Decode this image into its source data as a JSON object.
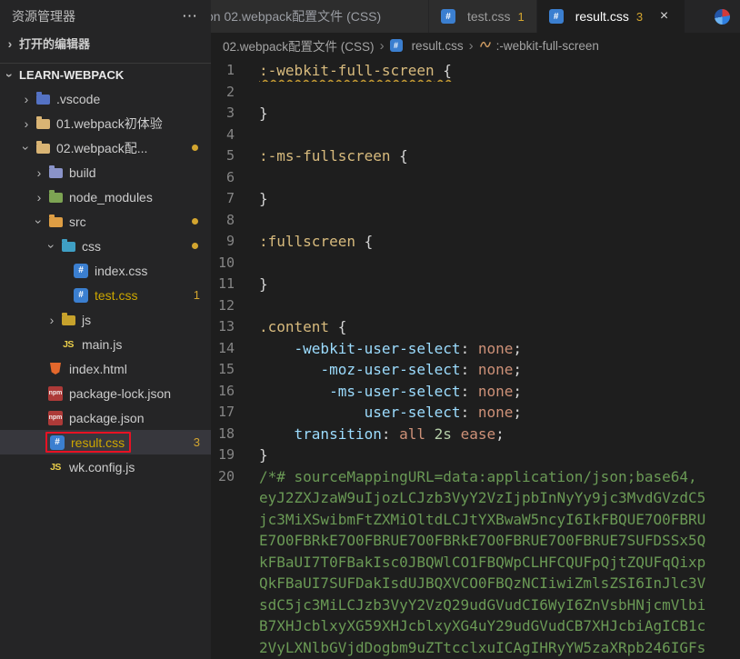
{
  "icons": {
    "chevron": "›",
    "close": "×",
    "more": "⋯",
    "css_glyph": "#",
    "js_glyph": "JS",
    "npm_glyph": "npm"
  },
  "sidebar": {
    "title": "资源管理器",
    "open_editors_label": "打开的编辑器",
    "section_label": "LEARN-WEBPACK",
    "tree": [
      {
        "id": "vscode-folder",
        "label": ".vscode",
        "level": 1,
        "chevron": "collapsed",
        "icon": "folder",
        "folder_color": "#5472c4"
      },
      {
        "id": "01-webpack",
        "label": "01.webpack初体验",
        "level": 1,
        "chevron": "collapsed",
        "icon": "folder",
        "folder_color": "#d9b474"
      },
      {
        "id": "02-webpack",
        "label": "02.webpack配...",
        "level": 1,
        "chevron": "expanded",
        "icon": "folder",
        "folder_color": "#d9b474",
        "dot": true
      },
      {
        "id": "build",
        "label": "build",
        "level": 2,
        "chevron": "collapsed",
        "icon": "folder",
        "folder_color": "#8a93c9"
      },
      {
        "id": "node-modules",
        "label": "node_modules",
        "level": 2,
        "chevron": "collapsed",
        "icon": "folder",
        "folder_color": "#7da453"
      },
      {
        "id": "src",
        "label": "src",
        "level": 2,
        "chevron": "expanded",
        "icon": "folder",
        "folder_color": "#de9e44",
        "dot": true
      },
      {
        "id": "css-folder",
        "label": "css",
        "level": 3,
        "chevron": "expanded",
        "icon": "folder",
        "folder_color": "#3f9fc4",
        "dot": true
      },
      {
        "id": "index-css",
        "label": "index.css",
        "level": 4,
        "icon": "css"
      },
      {
        "id": "test-css",
        "label": "test.css",
        "level": 4,
        "icon": "css",
        "badge": "1",
        "warn": true
      },
      {
        "id": "js-folder",
        "label": "js",
        "level": 3,
        "chevron": "collapsed",
        "icon": "folder",
        "folder_color": "#c7a22c"
      },
      {
        "id": "main-js",
        "label": "main.js",
        "level": 3,
        "icon": "js"
      },
      {
        "id": "index-html",
        "label": "index.html",
        "level": 2,
        "icon": "html"
      },
      {
        "id": "package-lock-json",
        "label": "package-lock.json",
        "level": 2,
        "icon": "npm"
      },
      {
        "id": "package-json",
        "label": "package.json",
        "level": 2,
        "icon": "npm"
      },
      {
        "id": "result-css",
        "label": "result.css",
        "level": 2,
        "icon": "css",
        "badge": "3",
        "warn": true,
        "selected": true,
        "outlined": true
      },
      {
        "id": "wk-config-js",
        "label": "wk.config.js",
        "level": 2,
        "icon": "js"
      }
    ]
  },
  "tabbar": {
    "tabs": [
      {
        "id": "tab-02-webpack",
        "label": "on 02.webpack配置文件 (CSS)",
        "clipped": true
      },
      {
        "id": "tab-test-css",
        "label": "test.css",
        "icon": "css",
        "badge": "1"
      },
      {
        "id": "tab-result-css",
        "label": "result.css",
        "icon": "css",
        "badge": "3",
        "active": true,
        "closable": true
      }
    ]
  },
  "breadcrumb": {
    "items": [
      {
        "id": "crumb-folder",
        "label": "02.webpack配置文件 (CSS)"
      },
      {
        "id": "crumb-file",
        "label": "result.css",
        "icon": "css"
      },
      {
        "id": "crumb-symbol",
        "label": ":-webkit-full-screen",
        "icon": "selector"
      }
    ]
  },
  "editor": {
    "lines": [
      {
        "n": "1",
        "tokens": [
          [
            "sel squig",
            ":-webkit-full-screen"
          ],
          [
            "punc squig",
            " {"
          ]
        ]
      },
      {
        "n": "2",
        "tokens": []
      },
      {
        "n": "3",
        "tokens": [
          [
            "punc",
            "}"
          ]
        ]
      },
      {
        "n": "4",
        "tokens": []
      },
      {
        "n": "5",
        "tokens": [
          [
            "sel",
            ":-ms-fullscreen"
          ],
          [
            "punc",
            " {"
          ]
        ]
      },
      {
        "n": "6",
        "tokens": []
      },
      {
        "n": "7",
        "tokens": [
          [
            "punc",
            "}"
          ]
        ]
      },
      {
        "n": "8",
        "tokens": []
      },
      {
        "n": "9",
        "tokens": [
          [
            "sel",
            ":fullscreen"
          ],
          [
            "punc",
            " {"
          ]
        ]
      },
      {
        "n": "10",
        "tokens": []
      },
      {
        "n": "11",
        "tokens": [
          [
            "punc",
            "}"
          ]
        ]
      },
      {
        "n": "12",
        "tokens": []
      },
      {
        "n": "13",
        "tokens": [
          [
            "sel",
            ".content"
          ],
          [
            "punc",
            " {"
          ]
        ]
      },
      {
        "n": "14",
        "tokens": [
          [
            "plain",
            "    "
          ],
          [
            "prop",
            "-webkit-user-select"
          ],
          [
            "punc",
            ": "
          ],
          [
            "val",
            "none"
          ],
          [
            "punc",
            ";"
          ]
        ]
      },
      {
        "n": "15",
        "tokens": [
          [
            "plain",
            "       "
          ],
          [
            "prop",
            "-moz-user-select"
          ],
          [
            "punc",
            ": "
          ],
          [
            "val",
            "none"
          ],
          [
            "punc",
            ";"
          ]
        ]
      },
      {
        "n": "16",
        "tokens": [
          [
            "plain",
            "        "
          ],
          [
            "prop",
            "-ms-user-select"
          ],
          [
            "punc",
            ": "
          ],
          [
            "val",
            "none"
          ],
          [
            "punc",
            ";"
          ]
        ]
      },
      {
        "n": "17",
        "tokens": [
          [
            "plain",
            "            "
          ],
          [
            "prop",
            "user-select"
          ],
          [
            "punc",
            ": "
          ],
          [
            "val",
            "none"
          ],
          [
            "punc",
            ";"
          ]
        ]
      },
      {
        "n": "18",
        "tokens": [
          [
            "plain",
            "    "
          ],
          [
            "prop",
            "transition"
          ],
          [
            "punc",
            ": "
          ],
          [
            "val",
            "all"
          ],
          [
            "num",
            " 2s"
          ],
          [
            "val",
            " ease"
          ],
          [
            "punc",
            ";"
          ]
        ]
      },
      {
        "n": "19",
        "tokens": [
          [
            "punc",
            "}"
          ]
        ]
      },
      {
        "n": "20",
        "tokens": [
          [
            "comment",
            "/*# sourceMappingURL=data:application/json;base64,"
          ]
        ]
      },
      {
        "n": "",
        "tokens": [
          [
            "comment",
            "eyJ2ZXJzaW9uIjozLCJzb3VyY2VzIjpbInNyYy9jc3MvdGVzdC5"
          ]
        ]
      },
      {
        "n": "",
        "tokens": [
          [
            "comment",
            "jc3MiXSwibmFtZXMiOltdLCJtYXBwaW5ncyI6IkFBQUE7O0FBRU"
          ]
        ]
      },
      {
        "n": "",
        "tokens": [
          [
            "comment",
            "E7O0FBRkE7O0FBRUE7O0FBRkE7O0FBRUE7O0FBRUE7SUFDSSx5Q"
          ]
        ]
      },
      {
        "n": "",
        "tokens": [
          [
            "comment",
            "kFBaUI7T0FBakIsc0JBQWlCO1FBQWpCLHFCQUFpQjtZQUFqQixp"
          ]
        ]
      },
      {
        "n": "",
        "tokens": [
          [
            "comment",
            "QkFBaUI7SUFDakIsdUJBQXVCO0FBQzNCIiwiZmlsZSI6InJlc3V"
          ]
        ]
      },
      {
        "n": "",
        "tokens": [
          [
            "comment",
            "sdC5jc3MiLCJzb3VyY2VzQ29udGVudCI6WyI6ZnVsbHNjcmVlbi"
          ]
        ]
      },
      {
        "n": "",
        "tokens": [
          [
            "comment",
            "B7XHJcblxyXG59XHJcblxyXG4uY29udGVudCB7XHJcbiAgICB1c"
          ]
        ]
      },
      {
        "n": "",
        "tokens": [
          [
            "comment",
            "2VyLXNlbGVjdDogbm9uZTtcclxuICAgIHRyYW5zaXRpb246IGFs"
          ]
        ]
      }
    ]
  }
}
